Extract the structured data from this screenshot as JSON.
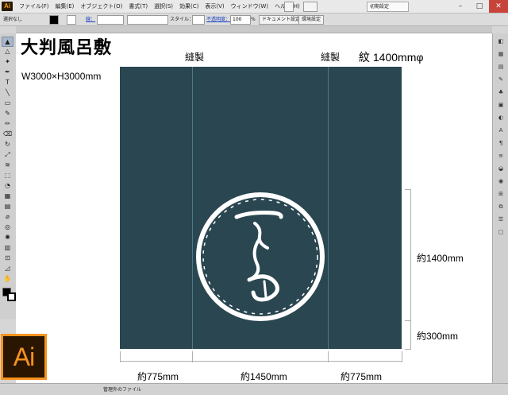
{
  "app": {
    "badge": "Ai",
    "logo": "Ai",
    "menus": [
      "ファイル(F)",
      "編集(E)",
      "オブジェクト(O)",
      "書式(T)",
      "選択(S)",
      "効果(C)",
      "表示(V)",
      "ウィンドウ(W)",
      "ヘルプ(H)"
    ],
    "workspace": "初期設定",
    "window_buttons": [
      "–",
      "□",
      "✕"
    ]
  },
  "controlbar": {
    "selection": "選択なし",
    "stroke_label": "線：",
    "style_label": "スタイル：",
    "opacity_label": "不透明度：",
    "opacity_value": "100",
    "opacity_unit": "%",
    "doc_settings": "ドキュメント設定",
    "env_settings": "環境設定"
  },
  "canvas": {
    "title": "大判風呂敷",
    "size": "W3000×H3000mm",
    "seam_left": "縫製",
    "seam_right": "縫製",
    "crest": "紋 1400mmφ",
    "dim_crest": "約1400mm",
    "dim_bottom": "約300mm",
    "dim_left": "約775mm",
    "dim_center": "約1450mm",
    "dim_right": "約775mm",
    "cloth_color": "#2a4650"
  },
  "statusbar": {
    "text": "管理外のファイル"
  },
  "icons": [
    "selection-tool-icon",
    "direct-selection-tool-icon",
    "pen-tool-icon",
    "type-tool-icon",
    "brush-tool-icon",
    "fill-swatch-icon"
  ]
}
